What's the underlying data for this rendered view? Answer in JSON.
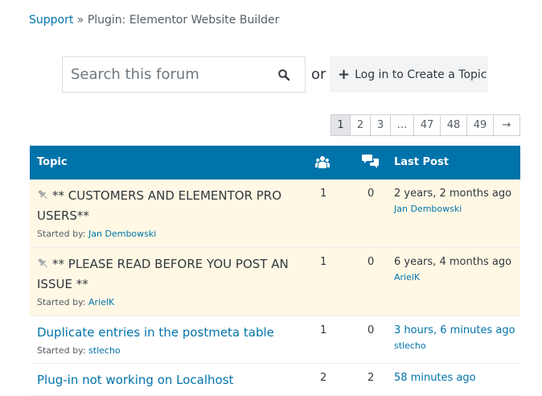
{
  "breadcrumb": {
    "root": "Support",
    "separator": "»",
    "current": "Plugin: Elementor Website Builder"
  },
  "search": {
    "placeholder": "Search this forum"
  },
  "or_text": "or",
  "login": {
    "label": "Log in to Create a Topic"
  },
  "pagination": [
    "1",
    "2",
    "3",
    "…",
    "47",
    "48",
    "49",
    "→"
  ],
  "table": {
    "headers": {
      "topic": "Topic",
      "last_post": "Last Post"
    },
    "rows": [
      {
        "title": "** CUSTOMERS AND ELEMENTOR PRO USERS**",
        "sticky": true,
        "started_label": "Started by:",
        "author": "Jan Dembowski",
        "voices": "1",
        "replies": "0",
        "last_time": "2 years, 2 months ago",
        "last_author": "Jan Dembowski"
      },
      {
        "title": "** PLEASE READ BEFORE YOU POST AN ISSUE **",
        "sticky": true,
        "started_label": "Started by:",
        "author": "ArielK",
        "voices": "1",
        "replies": "0",
        "last_time": "6 years, 4 months ago",
        "last_author": "ArielK"
      },
      {
        "title": "Duplicate entries in the postmeta table",
        "sticky": false,
        "started_label": "Started by:",
        "author": "stlecho",
        "voices": "1",
        "replies": "0",
        "last_time": "3 hours, 6 minutes ago",
        "last_author": "stlecho"
      },
      {
        "title": "Plug-in not working on Localhost",
        "sticky": false,
        "voices": "2",
        "replies": "2",
        "last_time": "58 minutes ago"
      }
    ]
  },
  "colors": {
    "link": "#0073aa",
    "header_bg": "#0073aa",
    "sticky_bg": "#fff8e5"
  }
}
